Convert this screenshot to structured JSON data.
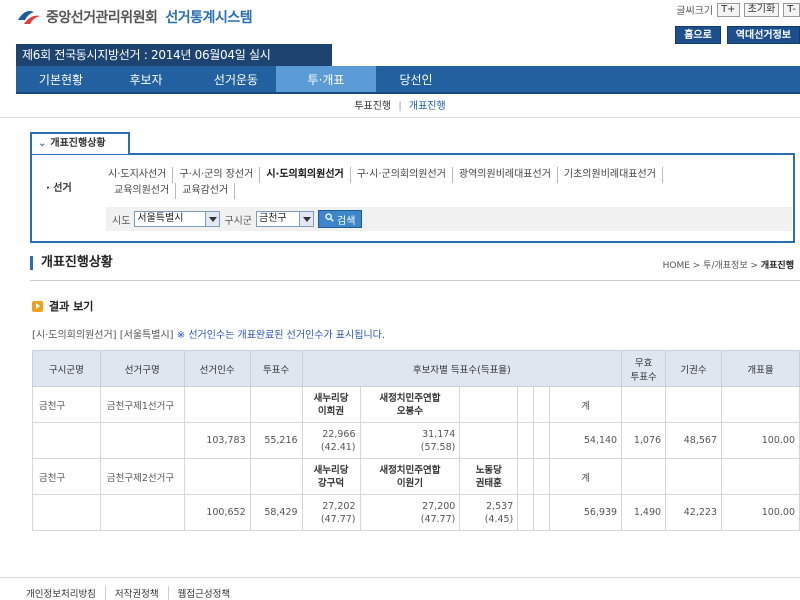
{
  "header": {
    "org_name": "중앙선거관리위원회",
    "system_name": "선거통계시스템",
    "font_size_label": "글씨크기",
    "font_plus": "T+",
    "font_reset": "초기화",
    "font_minus": "T-",
    "home_button": "홈으로",
    "past_election_button": "역대선거정보"
  },
  "election_banner": "제6회 전국동시지방선거 : 2014년 06월04일 실시",
  "gnb": [
    "기본현황",
    "후보자",
    "선거운동",
    "투·개표",
    "당선인"
  ],
  "gnb_active_index": 3,
  "subnav": {
    "item1": "투표진행",
    "separator": "|",
    "item2": "개표진행"
  },
  "filter": {
    "tab_label": "개표진행상황",
    "section_label": "선거",
    "elections": [
      "시·도지사선거",
      "구·시·군의 장선거",
      "시·도의회의원선거",
      "구·시·군의회의원선거",
      "광역의원비례대표선거",
      "기초의원비례대표선거",
      "교육의원선거",
      "교육감선거"
    ],
    "selected_election_index": 2,
    "sido_label": "시도",
    "sido_value": "서울특별시",
    "gusigun_label": "구시군",
    "gusigun_value": "금천구",
    "search_button": "검색"
  },
  "page": {
    "title": "개표진행상황",
    "breadcrumb": {
      "home": "HOME",
      "level1": "투/개표정보",
      "current": "개표진행"
    }
  },
  "result": {
    "heading": "결과 보기",
    "notice_prefix": "[시·도의회의원선거] [서울특별시]",
    "notice_blue": "※ 선거인수는 개표완료된 선거인수가 표시됩니다."
  },
  "table": {
    "headers": {
      "district": "구시군명",
      "constituency": "선거구명",
      "electors": "선거인수",
      "votes_cast": "투표수",
      "candidates": "후보자별 득표수(득표율)",
      "invalid_line1": "무효",
      "invalid_line2": "투표수",
      "abstention": "기권수",
      "progress": "개표율"
    },
    "total_label": "계",
    "rows": [
      {
        "district": "금천구",
        "constituency": "금천구제1선거구",
        "candidates": [
          {
            "party": "새누리당",
            "name": "이희권",
            "votes": "22,966",
            "pct": "(42.41)"
          },
          {
            "party": "새정치민주연합",
            "name": "오봉수",
            "votes": "31,174",
            "pct": "(57.58)"
          },
          {
            "party": "",
            "name": "",
            "votes": "",
            "pct": ""
          }
        ],
        "electors": "103,783",
        "votes_cast": "55,216",
        "total": "54,140",
        "invalid": "1,076",
        "abstention": "48,567",
        "progress": "100.00"
      },
      {
        "district": "금천구",
        "constituency": "금천구제2선거구",
        "candidates": [
          {
            "party": "새누리당",
            "name": "강구덕",
            "votes": "27,202",
            "pct": "(47.77)"
          },
          {
            "party": "새정치민주연합",
            "name": "이원기",
            "votes": "27,200",
            "pct": "(47.77)"
          },
          {
            "party": "노동당",
            "name": "권태훈",
            "votes": "2,537",
            "pct": "(4.45)"
          }
        ],
        "electors": "100,652",
        "votes_cast": "58,429",
        "total": "56,939",
        "invalid": "1,490",
        "abstention": "42,223",
        "progress": "100.00"
      }
    ]
  },
  "footer": [
    "개인정보처리방침",
    "저작권정책",
    "웹접근성정책"
  ]
}
